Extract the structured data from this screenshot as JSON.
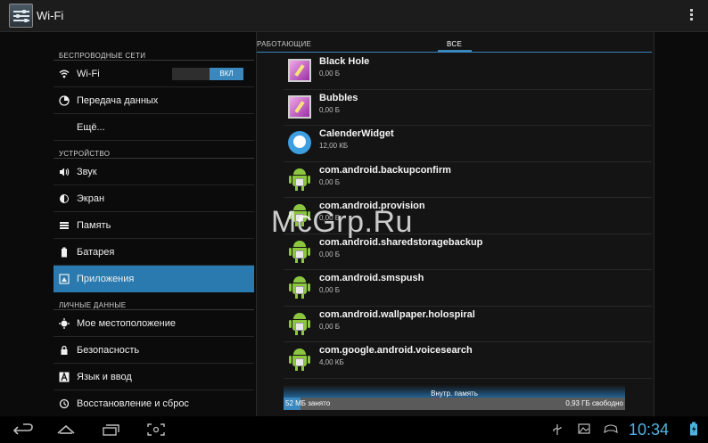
{
  "actionbar": {
    "title": "Wi-Fi"
  },
  "sidebar": {
    "sections": [
      {
        "label": "БЕСПРОВОДНЫЕ СЕТИ"
      },
      {
        "label": "УСТРОЙСТВО"
      },
      {
        "label": "ЛИЧНЫЕ ДАННЫЕ"
      }
    ],
    "items": [
      {
        "label": "Wi-Fi",
        "icon": "wifi-icon",
        "toggle": "ВКЛ"
      },
      {
        "label": "Передача данных",
        "icon": "data-usage-icon"
      },
      {
        "label": "Ещё..."
      },
      {
        "label": "Звук",
        "icon": "speaker-icon"
      },
      {
        "label": "Экран",
        "icon": "brightness-icon"
      },
      {
        "label": "Память",
        "icon": "storage-icon"
      },
      {
        "label": "Батарея",
        "icon": "battery-icon"
      },
      {
        "label": "Приложения",
        "icon": "apps-icon",
        "selected": true
      },
      {
        "label": "Мое местоположение",
        "icon": "location-icon"
      },
      {
        "label": "Безопасность",
        "icon": "lock-icon"
      },
      {
        "label": "Язык и ввод",
        "icon": "language-icon"
      },
      {
        "label": "Восстановление и сброс",
        "icon": "backup-icon"
      }
    ]
  },
  "tabs": [
    {
      "label": "РАБОТАЮЩИЕ"
    },
    {
      "label": "ВСЕ",
      "selected": true
    }
  ],
  "apps": [
    {
      "name": "Black Hole",
      "size": "0,00 Б",
      "icon": "black-hole-icon"
    },
    {
      "name": "Bubbles",
      "size": "0,00 Б",
      "icon": "bubbles-icon"
    },
    {
      "name": "CalenderWidget",
      "size": "12,00 КБ",
      "icon": "calender-widget-icon"
    },
    {
      "name": "com.android.backupconfirm",
      "size": "0,00 Б",
      "icon": "android-icon"
    },
    {
      "name": "com.android.provision",
      "size": "0,00 Б",
      "icon": "android-icon"
    },
    {
      "name": "com.android.sharedstoragebackup",
      "size": "0,00 Б",
      "icon": "android-icon"
    },
    {
      "name": "com.android.smspush",
      "size": "0,00 Б",
      "icon": "android-icon"
    },
    {
      "name": "com.android.wallpaper.holospiral",
      "size": "0,00 Б",
      "icon": "android-icon"
    },
    {
      "name": "com.google.android.voicesearch",
      "size": "4,00 КБ",
      "icon": "android-icon"
    }
  ],
  "storage": {
    "label": "Внутр. память",
    "used": "52 МБ занято",
    "free": "0,93 ГБ свободно",
    "used_fraction": 0.05
  },
  "watermark": "McGrp.Ru",
  "statusbar": {
    "time": "10:34"
  },
  "colors": {
    "accent": "#3a88bd",
    "clock": "#4fb2e6",
    "android": "#8cc63f"
  }
}
